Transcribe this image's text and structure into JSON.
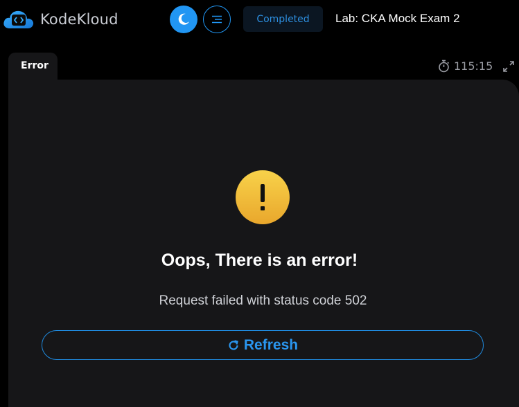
{
  "header": {
    "brand": "KodeKloud",
    "status": "Completed",
    "lab_title": "Lab: CKA Mock Exam 2"
  },
  "panel": {
    "tab_label": "Error",
    "timer": "115:15",
    "error_title": "Oops, There is an error!",
    "error_message": "Request failed with status code 502",
    "refresh_label": "Refresh"
  },
  "icons": [
    "logo-icon",
    "moon-icon",
    "menu-icon",
    "stopwatch-icon",
    "expand-icon",
    "warning-icon",
    "refresh-icon"
  ],
  "colors": {
    "accent": "#2196f3",
    "warning": "#f5c542",
    "panel_bg": "#161618",
    "page_bg": "#000000"
  }
}
